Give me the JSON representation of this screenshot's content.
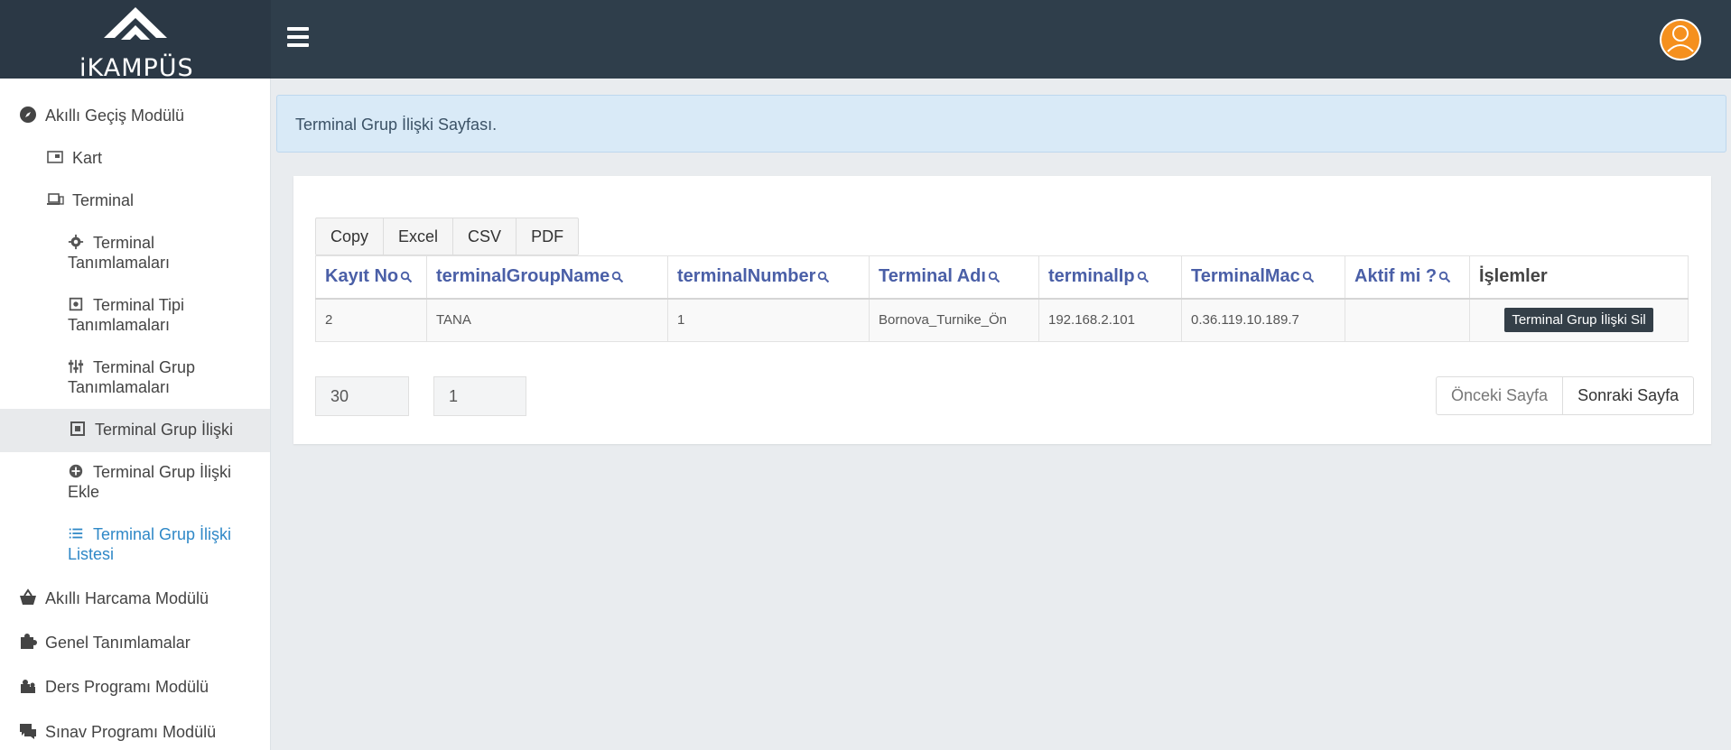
{
  "app": {
    "logo_text": "iKAMPÜS"
  },
  "sidebar": {
    "items": [
      {
        "label": "Akıllı Geçiş Modülü",
        "icon": "compass-icon"
      },
      {
        "label": "Kart",
        "icon": "card-icon"
      },
      {
        "label": "Terminal",
        "icon": "laptop-icon"
      },
      {
        "label": "Terminal Tanımlamaları",
        "icon": "gear-icon"
      },
      {
        "label": "Terminal Tipi Tanımlamaları",
        "icon": "square-dot-icon"
      },
      {
        "label": "Terminal Grup Tanımlamaları",
        "icon": "sliders-icon"
      },
      {
        "label": "Terminal Grup İlişki",
        "icon": "link-square-icon"
      },
      {
        "label": "Terminal Grup İlişki Ekle",
        "icon": "plus-circle-icon"
      },
      {
        "label": "Terminal Grup İlişki Listesi",
        "icon": "list-icon"
      },
      {
        "label": "Akıllı Harcama Modülü",
        "icon": "basket-icon"
      },
      {
        "label": "Genel Tanımlamalar",
        "icon": "puzzle-icon"
      },
      {
        "label": "Ders Programı Modülü",
        "icon": "puzzle-piece-icon"
      },
      {
        "label": "Sınav Programı Modülü",
        "icon": "chat-icon"
      }
    ]
  },
  "alert": {
    "text": "Terminal Grup İlişki Sayfası."
  },
  "export_buttons": [
    "Copy",
    "Excel",
    "CSV",
    "PDF"
  ],
  "table": {
    "columns": [
      "Kayıt No",
      "terminalGroupName",
      "terminalNumber",
      "Terminal Adı",
      "terminalIp",
      "TerminalMac",
      "Aktif mi ?",
      "İşlemler"
    ],
    "rows": [
      {
        "kayit_no": "2",
        "group_name": "TANA",
        "terminal_number": "1",
        "terminal_adi": "Bornova_Turnike_Ön",
        "terminal_ip": "192.168.2.101",
        "terminal_mac": "0.36.119.10.189.7",
        "aktif": "",
        "action_label": "Terminal Grup İlişki Sil"
      }
    ]
  },
  "pagination": {
    "page_size": "30",
    "page_number": "1",
    "prev_label": "Önceki Sayfa",
    "next_label": "Sonraki Sayfa"
  },
  "colors": {
    "topbar": "#2f3e4b",
    "header_link": "#4a5fa7",
    "active_link": "#2f88c7",
    "avatar_orange": "#f5901e"
  }
}
